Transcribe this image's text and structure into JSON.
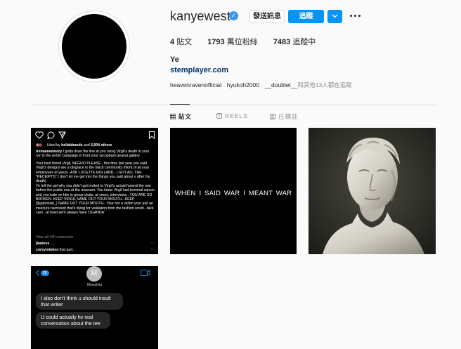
{
  "profile": {
    "username": "kanyewest",
    "verified_badge_icon": "checkmark-icon",
    "message_button": "發送訊息",
    "follow_button": "追蹤",
    "posts_count": "4",
    "posts_label": "貼文",
    "followers_count": "1793",
    "followers_label": "萬位粉絲",
    "following_count": "7483",
    "following_label": "追蹤中",
    "full_name": "Ye",
    "website": "stemplayer.com",
    "followed_by": {
      "names": [
        "heavenravenofficial",
        "hyukoh2000",
        "__doublet__"
      ],
      "separator": " · ",
      "suffix": "和其他13人都在追蹤"
    }
  },
  "tabs": [
    {
      "label": "貼文",
      "icon": "grid-icon"
    },
    {
      "label": "REELS",
      "icon": "reels-icon"
    },
    {
      "label": "已標註",
      "icon": "tagged-icon"
    }
  ],
  "posts": {
    "post1": {
      "liked_by": "Liked by",
      "liked_by_user": "bellabbands",
      "liked_and": "and",
      "liked_others": "5,604 others",
      "caption_user": "tremaineemory",
      "caption_intro": " I gotta draw the line at you using Virgil's death  in your 'ye' is the victim campaign in front your sycophant peanut gallery",
      "caption_body": "Your best friend Virgil, NEGRO PLEASE , this time last year you said Virgil's designs are a disgrace to the black community infont of all your employees at yeezy -ASK LUCETTE HOLLAND...I GOT ALL THE \"RECEIPTS\" ( don't let me get into the things you said about v after his death)",
      "caption_body2": "Ye tell the ppl why you didn't get invited to Virgil's actual funeral the one before the public one at the museum. You knew Virgil had terminal cancer and you rode on him in group chats, at yeezy, interviews...YOU ARE SO BROKEN. KEEP VIRGIL NAME OUT YOUR MOUTH...KEEP @gabrielsk_) NAME OUT YOUR MOUTH...Your not a victim your just an insecure narcissist that's dying for validation from the fashion world...take care...at least we'll always have 'UGANDA'",
      "view_all": "View all 440 comments",
      "comment1_user": "jbadvss",
      "comment1_text": " ....",
      "comment2_user": "coreytstokes",
      "comment2_text": " that part."
    },
    "post2": {
      "text": "WHEN I SAID WAR    I MEANT WAR"
    },
    "post3": {
      "subject": "statue-bust"
    },
    "post4": {
      "back_count": "25",
      "contact_initial": "M",
      "contact_name": "Mowalola",
      "message1": "I also don't think u should insult that writer",
      "message2": "U could actually hv real conversation about the tee"
    }
  },
  "colors": {
    "accent": "#0095f6",
    "link": "#00376b",
    "muted": "#8e8e8e",
    "border": "#dbdbdb"
  }
}
